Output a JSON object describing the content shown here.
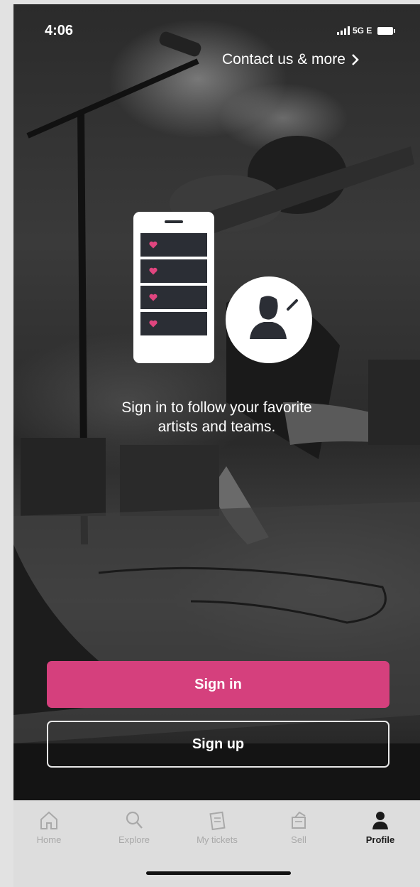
{
  "status_bar": {
    "time": "4:06",
    "network": "5G E"
  },
  "header": {
    "contact_label": "Contact us & more",
    "contact_chevron": "chevron-right-icon"
  },
  "illustration": {
    "phone_icon": "phone-favorites-icon",
    "heart_icon": "heart-icon",
    "avatar_icon": "user-edit-icon",
    "heart_color": "#e0457f"
  },
  "prompt": {
    "line1": "Sign in to follow your favorite",
    "line2": "artists and teams."
  },
  "buttons": {
    "sign_in": "Sign in",
    "sign_up": "Sign up"
  },
  "tab_bar": {
    "tabs": [
      {
        "label": "Home",
        "icon": "home-icon",
        "active": false
      },
      {
        "label": "Explore",
        "icon": "search-icon",
        "active": false
      },
      {
        "label": "My tickets",
        "icon": "tickets-icon",
        "active": false
      },
      {
        "label": "Sell",
        "icon": "sell-icon",
        "active": false
      },
      {
        "label": "Profile",
        "icon": "profile-icon",
        "active": true
      }
    ]
  },
  "colors": {
    "accent": "#d5407d",
    "tab_inactive": "#a9a9a9",
    "tab_active": "#1b1b1b"
  }
}
